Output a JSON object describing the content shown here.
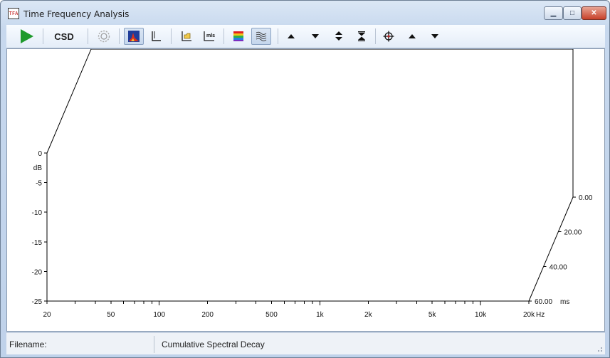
{
  "window": {
    "title": "Time Frequency Analysis",
    "icon": "spectrum-app-icon"
  },
  "toolbar": {
    "csd_label": "CSD",
    "buttons": [
      "play-icon",
      "CSD",
      "settings-icon",
      "waterfall-icon",
      "time-axis-icon",
      "load-icon",
      "mls-icon",
      "color-bars-icon",
      "spectrogram-icon",
      "arrow-up-icon",
      "arrow-down-icon",
      "expand-icon",
      "compress-icon",
      "crosshair-icon",
      "arrow-up-icon",
      "arrow-down-icon"
    ],
    "active": [
      "waterfall-icon",
      "spectrogram-icon"
    ]
  },
  "chart": {
    "type": "waterfall-3d",
    "y_axis": {
      "ticks": [
        "0",
        "-5",
        "-10",
        "-15",
        "-20",
        "-25"
      ],
      "unit": "dB"
    },
    "x_axis": {
      "ticks": [
        "20",
        "50",
        "100",
        "200",
        "500",
        "1k",
        "2k",
        "5k",
        "10k",
        "20k"
      ],
      "unit": "Hz"
    },
    "z_axis": {
      "ticks": [
        "0.00",
        "20.00",
        "40.00",
        "60.00"
      ],
      "unit": "ms"
    }
  },
  "chart_data": {
    "type": "waterfall",
    "title": "",
    "xlabel": "Hz",
    "ylabel": "dB",
    "zlabel": "ms",
    "xscale": "log",
    "xlim": [
      20,
      20000
    ],
    "ylim": [
      -25,
      0
    ],
    "zlim": [
      0,
      60
    ],
    "xticks": [
      20,
      50,
      100,
      200,
      500,
      1000,
      2000,
      5000,
      10000,
      20000
    ],
    "yticks": [
      0,
      -5,
      -10,
      -15,
      -20,
      -25
    ],
    "zticks": [
      0,
      20,
      40,
      60
    ],
    "series": []
  },
  "status": {
    "filename_label": "Filename:",
    "mode": "Cumulative Spectral Decay"
  },
  "colors": {
    "play": "#1e9a2c",
    "accent": "#3561a8"
  }
}
